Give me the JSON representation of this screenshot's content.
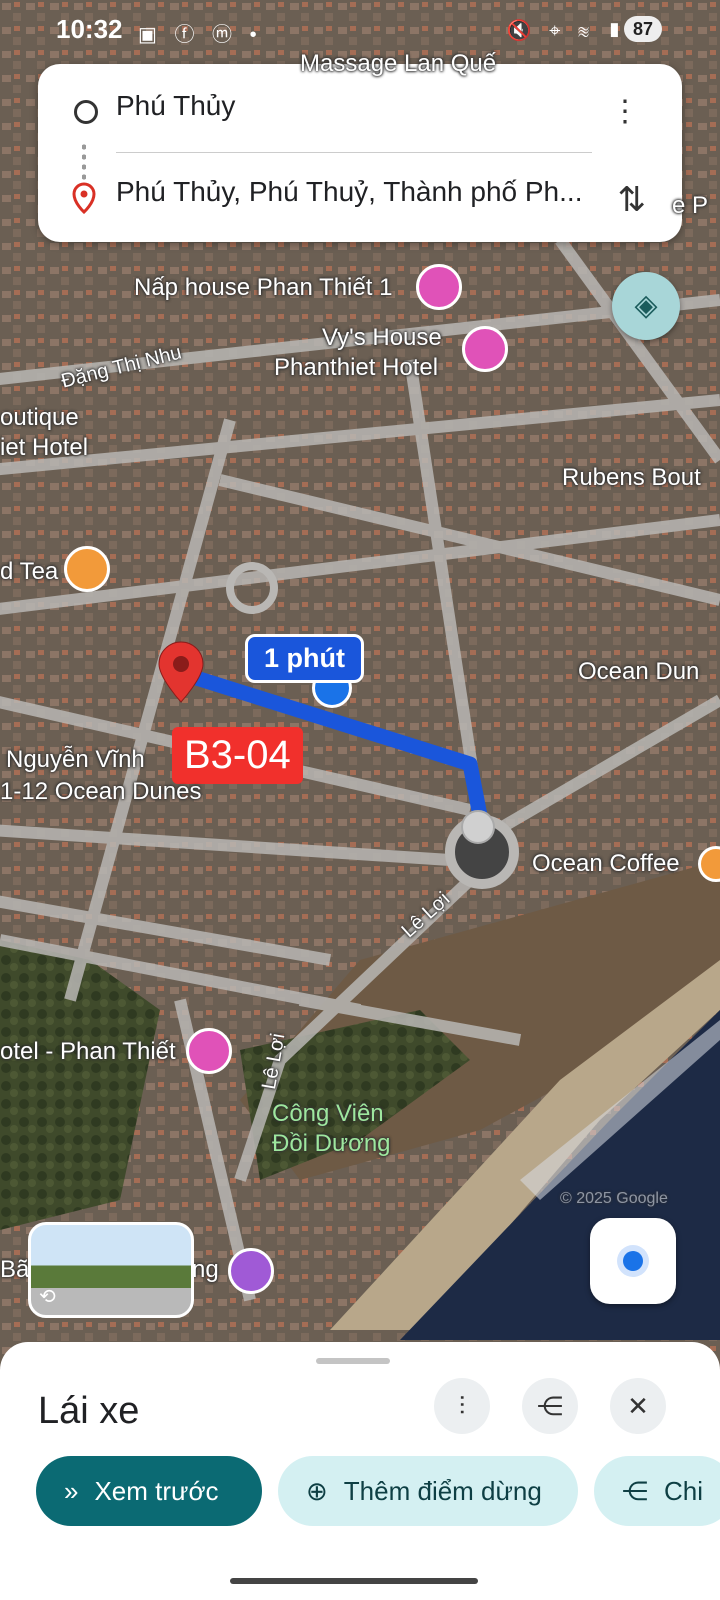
{
  "status_bar": {
    "time": "10:32",
    "battery": "87",
    "left_icons": [
      "screenshot-icon",
      "facebook-icon",
      "messenger-icon",
      "dot"
    ],
    "right_icons": [
      "mute-icon",
      "location-icon",
      "wifi-icon",
      "signal-icon"
    ]
  },
  "directions": {
    "origin": "Phú Thủy",
    "destination": "Phú Thủy, Phú Thuỷ, Thành phố Ph..."
  },
  "map": {
    "labels": {
      "massage": "Massage Lan Quế",
      "nap_house": "Nấp house Phan Thiết 1",
      "vys_house_1": "Vy's House",
      "vys_house_2": "Phanthiet Hotel",
      "dang_thi_nhu": "Đặng Thị Nhu",
      "boutique_1": "outique",
      "boutique_2": "iet Hotel",
      "rubens": "Rubens Bout",
      "tea": "d Tea",
      "ocean_dunes_right": "Ocean Dun",
      "nguyen_vinh_1": "Nguyễn Vĩnh",
      "nguyen_vinh_2": "1-12 Ocean Dunes",
      "ocean_coffee": "Ocean Coffee",
      "le_loi_1": "Lê Lợi",
      "le_loi_2": "Lê Lợi",
      "otel_phan_thiet": "otel - Phan Thiết",
      "cong_vien_1": "Công Viên",
      "cong_vien_2": "Đồi Dương",
      "ba_left": "Bã",
      "ng_right": "ng",
      "edge_e_p": "e P",
      "copyright": "© 2025 Google"
    },
    "eta": "1 phút",
    "parcel": "B3-04",
    "route_color": "#1a56db"
  },
  "bottom_sheet": {
    "title": "Lái xe",
    "preview": "Xem trước",
    "add_stop": "Thêm điểm dừng",
    "share": "Chi"
  }
}
